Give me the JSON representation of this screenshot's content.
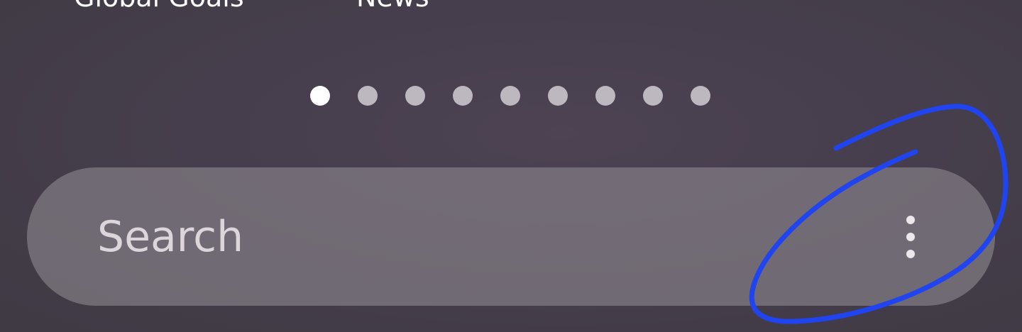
{
  "apps": [
    {
      "label": "Global Goals"
    },
    {
      "label": "News"
    }
  ],
  "page_indicator": {
    "total": 9,
    "active_index": 0
  },
  "search": {
    "placeholder": "Search",
    "menu_icon": "more-vert-icon"
  },
  "annotation": {
    "color": "#1f44f0"
  }
}
